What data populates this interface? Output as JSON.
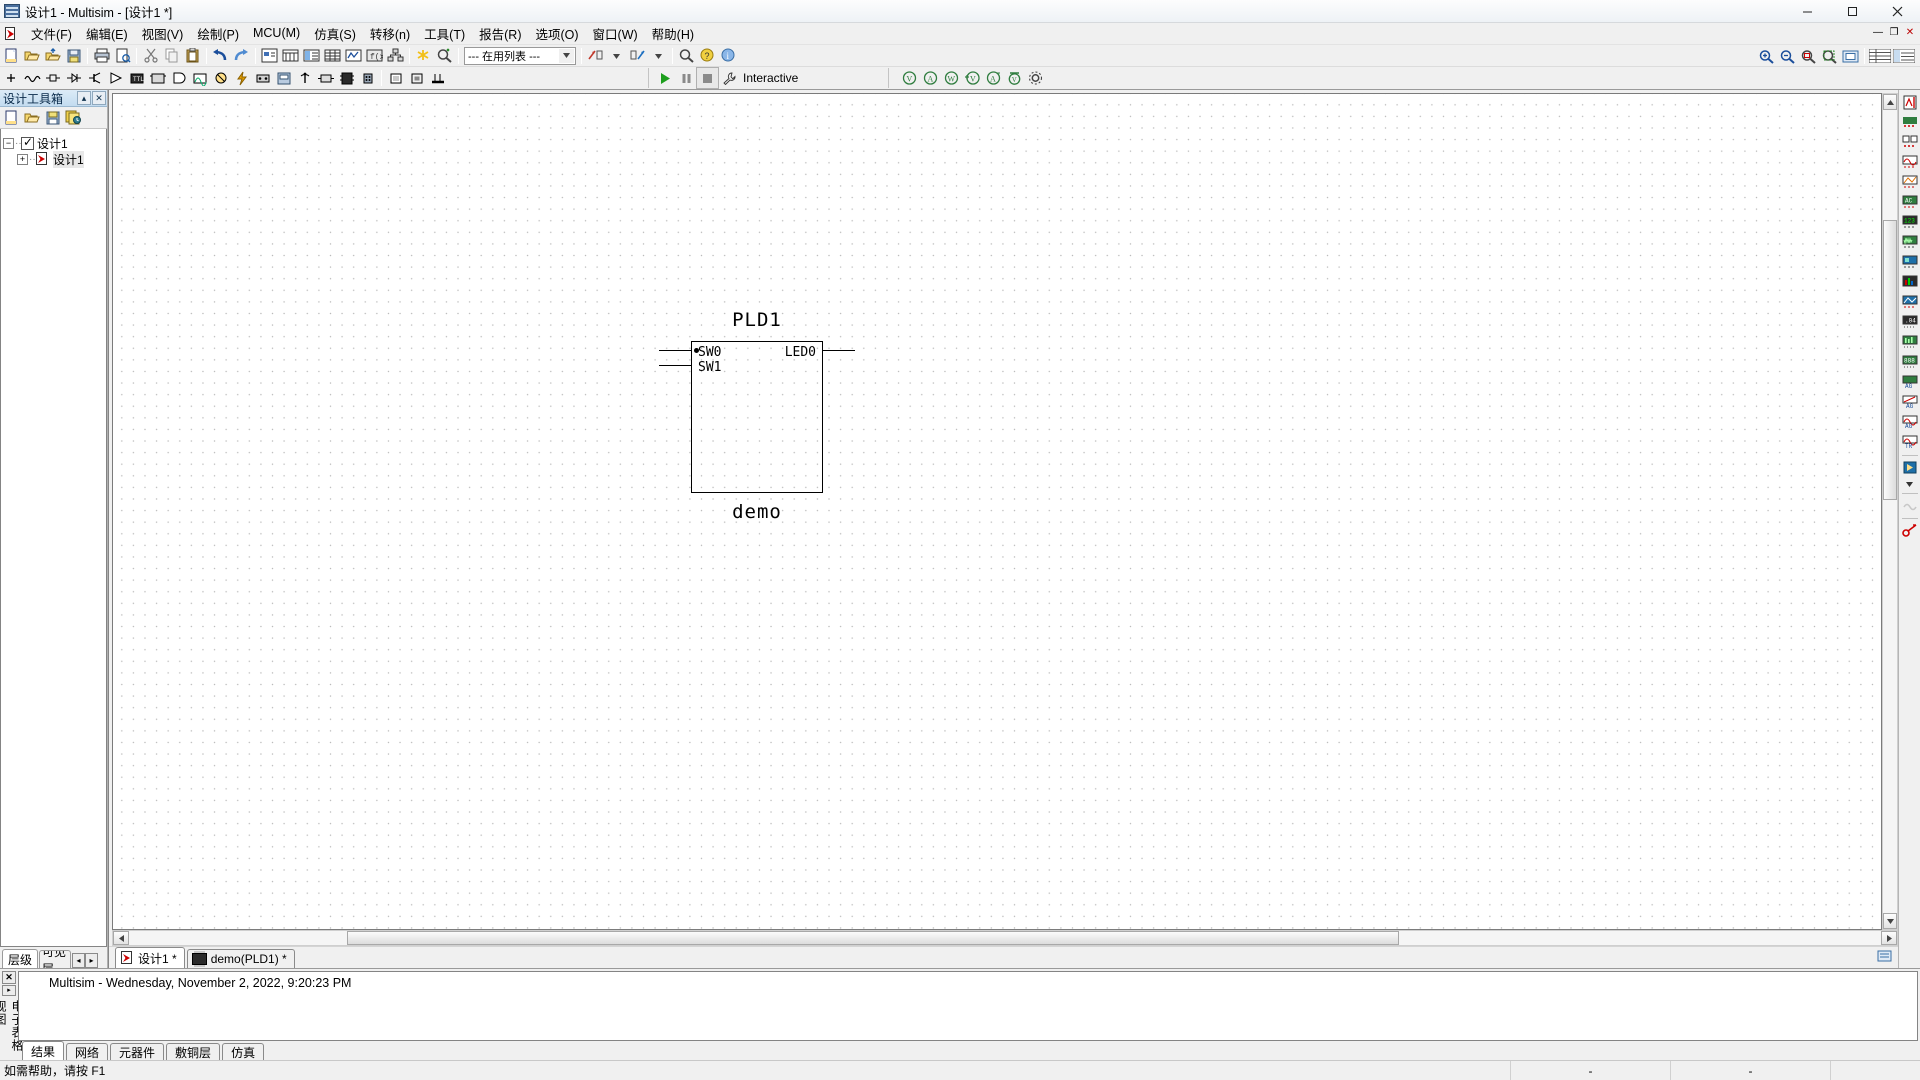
{
  "window": {
    "title": "设计1 - Multisim - [设计1 *]",
    "app_icon": "multisim-icon",
    "minimize": "—",
    "maximize": "❐",
    "close": "✕"
  },
  "menubar": {
    "items": [
      {
        "label": "文件(F)",
        "name": "menu-file"
      },
      {
        "label": "编辑(E)",
        "name": "menu-edit"
      },
      {
        "label": "视图(V)",
        "name": "menu-view"
      },
      {
        "label": "绘制(P)",
        "name": "menu-place"
      },
      {
        "label": "MCU(M)",
        "name": "menu-mcu"
      },
      {
        "label": "仿真(S)",
        "name": "menu-simulate"
      },
      {
        "label": "转移(n)",
        "name": "menu-transfer"
      },
      {
        "label": "工具(T)",
        "name": "menu-tools"
      },
      {
        "label": "报告(R)",
        "name": "menu-reports"
      },
      {
        "label": "选项(O)",
        "name": "menu-options"
      },
      {
        "label": "窗口(W)",
        "name": "menu-window"
      },
      {
        "label": "帮助(H)",
        "name": "menu-help"
      }
    ],
    "mdi_buttons": [
      "—",
      "❐",
      "✕"
    ]
  },
  "toolbar": {
    "in_use_list_value": "--- 在用列表 ---",
    "in_use_list_arrow": "▾",
    "groups": [
      [
        "new-file-icon",
        "open-file-icon",
        "open-sample-icon",
        "save-icon"
      ],
      [
        "print-icon",
        "print-preview-icon"
      ],
      [
        "cut-icon",
        "copy-icon",
        "paste-icon"
      ],
      [
        "undo-icon",
        "redo-icon"
      ],
      [
        "full-screen-icon",
        "parts-bin-icon",
        "design-toolbox-icon",
        "spreadsheet-icon",
        "grapher-icon",
        "postprocessor-icon",
        "hierarchy-icon"
      ],
      [
        "ercheck-icon",
        "find-icon"
      ],
      [
        "in-use-list-combo"
      ],
      [
        "back-annotate-icon",
        "forward-annotate-icon",
        "analysis-icon"
      ],
      [
        "zoom-area-icon",
        "help-icon",
        "about-icon"
      ]
    ],
    "right_group": [
      "zoom-in-icon",
      "zoom-out-icon",
      "zoom-fit-icon",
      "zoom-area2-icon",
      "zoom-full-icon",
      "show-grid-icon",
      "show-list-icon"
    ]
  },
  "toolbar2": {
    "simulation": {
      "run_label": "▶",
      "pause_label": "❚❚",
      "stop_label": "■",
      "mode_label": "Interactive",
      "mode_icon": "wrench-icon"
    },
    "left_icons": [
      "source-icon",
      "signal-icon",
      "basic-icon",
      "diode-icon",
      "transistor-icon",
      "analog-icon",
      "ttl-icon",
      "cmos-icon",
      "misc-digital-icon",
      "mixed-icon",
      "indicator-icon",
      "power-icon",
      "misc-icon",
      "advanced-peripherals-icon",
      "rf-icon",
      "electromechanical-icon",
      "nipld-icon",
      "connectors-icon",
      "mcu-icon",
      "hierarchy-block-icon",
      "bus-icon"
    ],
    "right_icons": [
      "multimeter-icon",
      "function-generator-icon",
      "wattmeter-icon",
      "oscilloscope-icon",
      "bode-plotter-icon",
      "frequency-counter-icon",
      "word-generator-icon",
      "logic-converter-icon",
      "logic-analyzer-icon",
      "distortion-analyzer-icon",
      "spectrum-analyzer-icon",
      "network-analyzer-icon"
    ]
  },
  "design_toolbox": {
    "title": "设计工具箱",
    "collapse_btn": "▴",
    "close_btn": "✕",
    "toolbar_icons": [
      "new-design-icon",
      "open-design-icon",
      "save-design-icon",
      "design-history-icon"
    ],
    "tree": [
      {
        "label": "设计1",
        "level": 0,
        "toggle": "−",
        "checked": true,
        "icon": "checkbox-icon"
      },
      {
        "label": "设计1",
        "level": 1,
        "toggle": "+",
        "checked": false,
        "icon": "schematic-doc-icon"
      }
    ],
    "tabs": [
      {
        "label": "层级",
        "active": true,
        "name": "tab-hierarchy"
      },
      {
        "label": "可见层",
        "active": false,
        "name": "tab-visibility"
      }
    ],
    "tab_prev": "◂",
    "tab_next": "▸"
  },
  "canvas": {
    "pld": {
      "ref_designator": "PLD1",
      "sub_label": "demo",
      "input_pins": [
        "SW0",
        "SW1"
      ],
      "output_pins": [
        "LED0"
      ]
    },
    "scroll": {
      "up_arrow": "▲",
      "down_arrow": "▼",
      "left_arrow": "◀",
      "right_arrow": "▶"
    }
  },
  "document_tabs": [
    {
      "label": "设计1 *",
      "icon": "schematic-doc-icon",
      "active": true,
      "name": "doc-tab-design1"
    },
    {
      "label": "demo(PLD1) *",
      "icon": "pld-chip-icon",
      "active": false,
      "name": "doc-tab-demo-pld1"
    }
  ],
  "spreadsheet": {
    "rail_label": "电子表格视图",
    "close_btn": "✕",
    "expand_btn": "▸",
    "result_text": "Multisim  -  Wednesday, November 2, 2022, 9:20:23 PM",
    "tabs": [
      {
        "label": "结果",
        "active": true,
        "name": "sheet-tab-results"
      },
      {
        "label": "网络",
        "active": false,
        "name": "sheet-tab-nets"
      },
      {
        "label": "元器件",
        "active": false,
        "name": "sheet-tab-components"
      },
      {
        "label": "敷铜层",
        "active": false,
        "name": "sheet-tab-copper-layers"
      },
      {
        "label": "仿真",
        "active": false,
        "name": "sheet-tab-simulation"
      }
    ]
  },
  "statusbar": {
    "hint": "如需帮助，请按 F1",
    "cell1": "-",
    "cell2": "-",
    "cell3": ""
  },
  "right_sidebar": {
    "icons": [
      "measurement-probe-icon",
      "dc-operating-point-icon",
      "ac-sweep-icon",
      "transient-icon",
      "dc-sweep-icon",
      "single-freq-ac-icon",
      "parameter-sweep-icon",
      "noise-icon",
      "monte-carlo-icon",
      "fourier-icon",
      "temperature-sweep-icon",
      "distortion-icon",
      "sensitivity-icon",
      "worst-case-icon",
      "pole-zero-icon",
      "transfer-function-icon",
      "trace-width-icon",
      "batched-analysis-icon",
      "user-defined-icon",
      "stop-analysis-icon",
      "probe-settings-icon"
    ]
  },
  "colors": {
    "accent_blue": "#4a6f9e",
    "panel_bg": "#f0f0f0",
    "canvas_bg": "#ffffff",
    "grid_dot": "#b9b9b9",
    "title_gradient_start": "#dcebf7",
    "title_gradient_end": "#c3dcf0"
  }
}
